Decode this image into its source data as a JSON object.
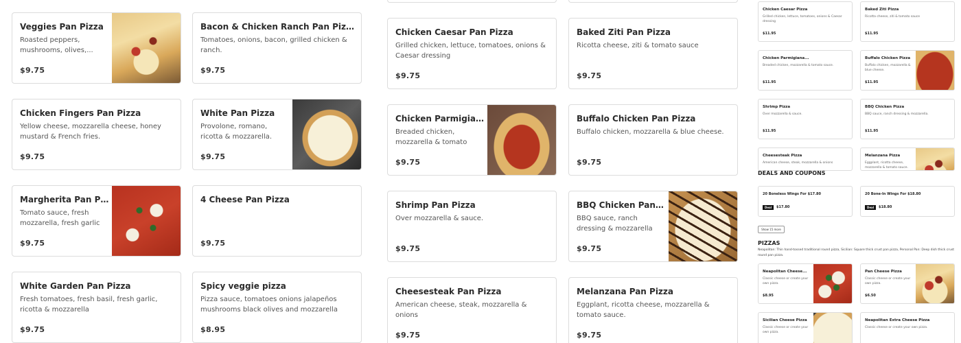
{
  "col1": [
    {
      "name": "Veggies Pan Pizza",
      "desc": "Roasted peppers, mushrooms, olives,...",
      "price": "$9.75"
    },
    {
      "name": "Chicken Fingers Pan Pizza",
      "desc": "Yellow cheese, mozzarella cheese, honey mustard & French fries.",
      "price": "$9.75"
    },
    {
      "name": "Margherita Pan Pizza",
      "desc": "Tomato sauce, fresh mozzarella, fresh garlic &...",
      "price": "$9.75"
    },
    {
      "name": "White Garden Pan Pizza",
      "desc": "Fresh tomatoes, fresh basil, fresh garlic, ricotta & mozzarella",
      "price": "$9.75"
    }
  ],
  "col2": [
    {
      "name": "Bacon & Chicken Ranch Pan Pizza",
      "desc": "Tomatoes, onions, bacon, grilled chicken & ranch.",
      "price": "$9.75"
    },
    {
      "name": "White Pan Pizza",
      "desc": "Provolone, romano, ricotta & mozzarella.",
      "price": "$9.75"
    },
    {
      "name": "4 Cheese Pan Pizza",
      "desc": "",
      "price": "$9.75"
    },
    {
      "name": "Spicy veggie pizza",
      "desc": "Pizza sauce, tomatoes onions jalapeños mushrooms black olives and mozzarella cheese",
      "price": "$8.95"
    }
  ],
  "col3": [
    {
      "name": "Chicken Caesar Pan Pizza",
      "desc": "Grilled chicken, lettuce, tomatoes, onions & Caesar dressing",
      "price": "$9.75"
    },
    {
      "name": "Chicken Parmigiana...",
      "desc": "Breaded chicken, mozzarella & tomato sauce.",
      "price": "$9.75"
    },
    {
      "name": "Shrimp Pan Pizza",
      "desc": "Over mozzarella & sauce.",
      "price": "$9.75"
    },
    {
      "name": "Cheesesteak Pan Pizza",
      "desc": "American cheese, steak, mozzarella & onions",
      "price": "$9.75"
    }
  ],
  "col4": [
    {
      "name": "Baked Ziti Pan Pizza",
      "desc": "Ricotta cheese, ziti & tomato sauce",
      "price": "$9.75"
    },
    {
      "name": "Buffalo Chicken Pan Pizza",
      "desc": "Buffalo chicken, mozzarella & blue cheese.",
      "price": "$9.75"
    },
    {
      "name": "BBQ Chicken Pan Pizza",
      "desc": "BBQ sauce, ranch dressing & mozzarella",
      "price": "$9.75"
    },
    {
      "name": "Melanzana Pan Pizza",
      "desc": "Eggplant, ricotta cheese, mozzarella & tomato sauce.",
      "price": "$9.75"
    }
  ],
  "mini": [
    {
      "name": "Chicken Caesar Pizza",
      "desc": "Grilled chicken, lettuce, tomatoes, onions & Caesar dressing",
      "price": "$11.95"
    },
    {
      "name": "Baked Ziti Pizza",
      "desc": "Ricotta cheese, ziti & tomato sauce",
      "price": "$11.95"
    },
    {
      "name": "Chicken Parmigiana...",
      "desc": "Breaded chicken, mozzarella & tomato sauce.",
      "price": "$11.95"
    },
    {
      "name": "Buffalo Chicken Pizza",
      "desc": "Buffalo chicken, mozzarella & blue cheese.",
      "price": "$11.95"
    },
    {
      "name": "Shrimp Pizza",
      "desc": "Over mozzarella & sauce.",
      "price": "$11.95"
    },
    {
      "name": "BBQ Chicken Pizza",
      "desc": "BBQ sauce, ranch dressing & mozzarella.",
      "price": "$11.95"
    },
    {
      "name": "Cheesesteak Pizza",
      "desc": "American cheese, steak, mozzarella & onions",
      "price": ""
    },
    {
      "name": "Melanzana Pizza",
      "desc": "Eggplant, ricotta cheese, mozzarella & tomato sauce.",
      "price": ""
    }
  ],
  "deals": {
    "title": "DEALS AND COUPONS",
    "items": [
      {
        "name": "20 Boneless Wings For $17.80",
        "badge": "Deal",
        "price": "$17.80"
      },
      {
        "name": "20 Bone-In Wings For $18.80",
        "badge": "Deal",
        "price": "$18.80"
      }
    ],
    "show_more": "Show 15 more"
  },
  "pizzas": {
    "title": "PIZZAS",
    "note": "Neapolitan: Thin hand-tossed traditional round pizza, Sicilian: Square thick crust pan pizza, Personal Pan: Deep dish thick crust round pan pizza.",
    "items": [
      {
        "name": "Neapolitan Cheese...",
        "desc": "Classic cheese or create your own pizza.",
        "price": "$8.95"
      },
      {
        "name": "Pan Cheese Pizza",
        "desc": "Classic cheese or create your own pizza.",
        "price": "$6.50"
      },
      {
        "name": "Sicilian Cheese Pizza",
        "desc": "Classic cheese or create your own pizza.",
        "price": ""
      },
      {
        "name": "Neapolitan Extra Cheese Pizza",
        "desc": "Classic cheese or create your own pizza.",
        "price": ""
      }
    ]
  }
}
